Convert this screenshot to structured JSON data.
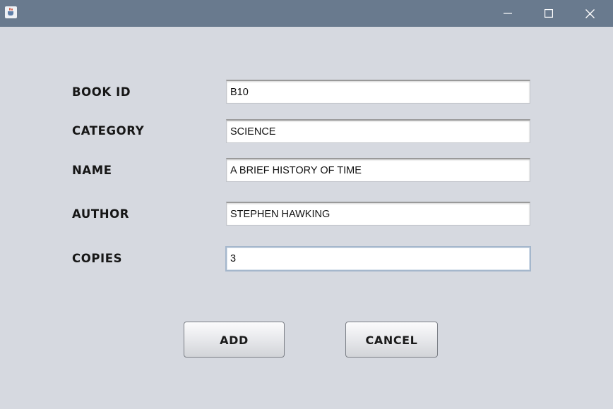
{
  "window": {
    "title": "",
    "icon": "java-cup-icon",
    "controls": {
      "minimize": "minimize-icon",
      "maximize": "maximize-icon",
      "close": "close-icon"
    },
    "colors": {
      "titlebar": "#697a8e",
      "background": "#d6d9e0"
    }
  },
  "form": {
    "fields": [
      {
        "label": "BOOK ID",
        "value": "B10"
      },
      {
        "label": "CATEGORY",
        "value": "SCIENCE"
      },
      {
        "label": "NAME",
        "value": "A BRIEF HISTORY OF TIME"
      },
      {
        "label": "AUTHOR",
        "value": "STEPHEN HAWKING"
      },
      {
        "label": "COPIES",
        "value": "3"
      }
    ],
    "focused_field": "COPIES"
  },
  "buttons": {
    "add_label": "ADD",
    "cancel_label": "CANCEL"
  }
}
